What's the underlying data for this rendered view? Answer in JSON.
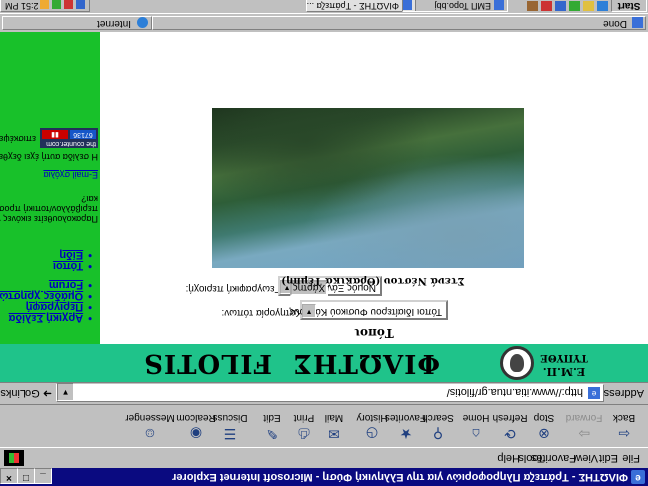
{
  "window": {
    "title": "ΦΙΛΩΤΗΣ - Τράπεζα Πληροφοριών για την Ελληνική Φύση - Microsoft Internet Explorer",
    "minimize": "_",
    "maximize": "□",
    "close": "×"
  },
  "menu": [
    "File",
    "Edit",
    "View",
    "Favorites",
    "Tools",
    "Help"
  ],
  "toolbar": {
    "back": "Back",
    "forward": "Forward",
    "stop": "Stop",
    "refresh": "Refresh",
    "home": "Home",
    "search": "Search",
    "favorites": "Favorites",
    "history": "History",
    "mail": "Mail",
    "print": "Print",
    "edit": "Edit",
    "discuss": "Discuss",
    "realcom": "Realcom",
    "messenger": "Messenger"
  },
  "address": {
    "label": "Address",
    "url": "http://www.itia.ntua.gr/filotis/",
    "go": "Go",
    "links": "Links"
  },
  "banner": {
    "logo_line1": "Ε.Μ.Π.",
    "logo_line2": "ΤΥΠΥΘΕ",
    "left": "ΦΙΛΩΤΗΣ",
    "right": "FILOTIS"
  },
  "sidebar": {
    "nav_top": [
      "Αρχική Σελίδα",
      "Περιγραφή",
      "Ομάδες χρηστών",
      "Forum"
    ],
    "nav_bottom": [
      "Τόποι",
      "Είδη"
    ],
    "note_lines": [
      "Παρακολουθείτε εικόνες για το",
      "περιβάλλον/τοπική προσέγγιση",
      "και?"
    ],
    "email_link": "E-mail σχόλια",
    "visit_line": "Η σελίδα αυτή έχει δεχθεί",
    "counter_header": "the counter.com",
    "counter_visits": "67136",
    "counter_label": "επισκέψεις"
  },
  "main": {
    "title": "Τόποι",
    "category_label": "Κατηγορία τόπων:",
    "category_value": "Τόποι Ιδιαίτερου Φυσικού Κάλλους",
    "region_label": "Γεωγραφική περιοχή:",
    "region_value": "Νομός Ξάνθης",
    "maps_button": "Χάρτης",
    "photo_caption": "Στενά Νέστου (Θρακικά Τέμπη)"
  },
  "status": {
    "left": "Done",
    "right": "Internet"
  },
  "taskbar": {
    "start": "Start",
    "tasks": [
      "ΦΙΛΩΤΗΣ - Τράπεζα ...",
      "ΕΜΠ Topo.bbj"
    ],
    "time": "2:51 PM"
  }
}
